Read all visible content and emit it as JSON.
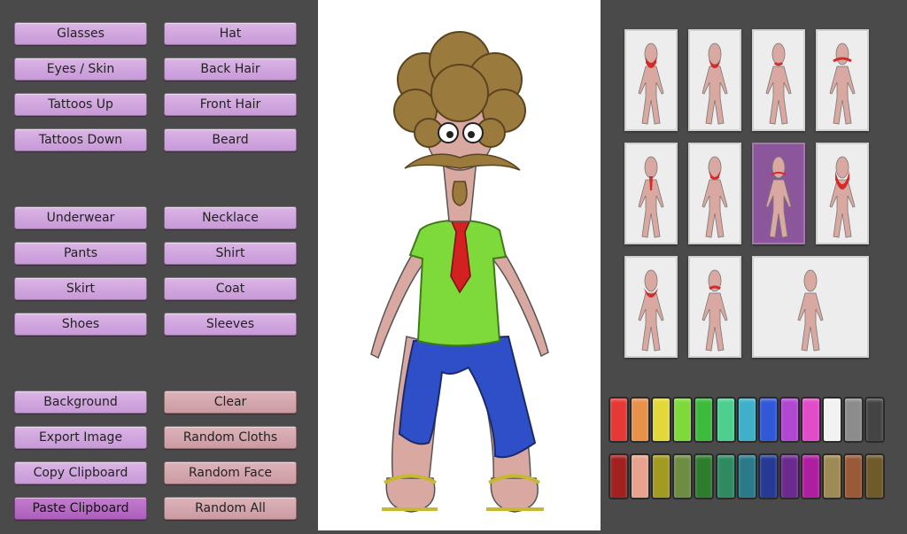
{
  "left_buttons": {
    "glasses": "Glasses",
    "hat": "Hat",
    "eyes_skin": "Eyes / Skin",
    "back_hair": "Back Hair",
    "tattoos_up": "Tattoos Up",
    "front_hair": "Front Hair",
    "tattoos_down": "Tattoos Down",
    "beard": "Beard",
    "underwear": "Underwear",
    "necklace": "Necklace",
    "pants": "Pants",
    "shirt": "Shirt",
    "skirt": "Skirt",
    "coat": "Coat",
    "shoes": "Shoes",
    "sleeves": "Sleeves",
    "background": "Background",
    "clear": "Clear",
    "export_image": "Export Image",
    "random_cloths": "Random Cloths",
    "copy_clipboard": "Copy Clipboard",
    "random_face": "Random Face",
    "paste_clipboard": "Paste Clipboard",
    "random_all": "Random All"
  },
  "beard_options": {
    "selected_index": 6,
    "count": 11
  },
  "palette": {
    "row1": [
      "#e53935",
      "#e8914a",
      "#e3d83a",
      "#7ed93a",
      "#3cbb3c",
      "#4fcf8f",
      "#3fb0c8",
      "#3158d6",
      "#b048d2",
      "#e14cc8",
      "#f2f2f2",
      "#8c8c8c",
      "#444444"
    ],
    "row2": [
      "#a32020",
      "#e8a28e",
      "#a39a22",
      "#6d8d42",
      "#2e7d2e",
      "#2f8a62",
      "#2a7a8a",
      "#243a94",
      "#6b2a8e",
      "#ad1f9e",
      "#9e8a55",
      "#9a5a38",
      "#6e5a2a"
    ]
  },
  "colors": {
    "button": "#d4a9e0",
    "button_alt": "#d5a7ae",
    "button_active": "#b96cc5",
    "selected_thumb": "#8b579a"
  }
}
